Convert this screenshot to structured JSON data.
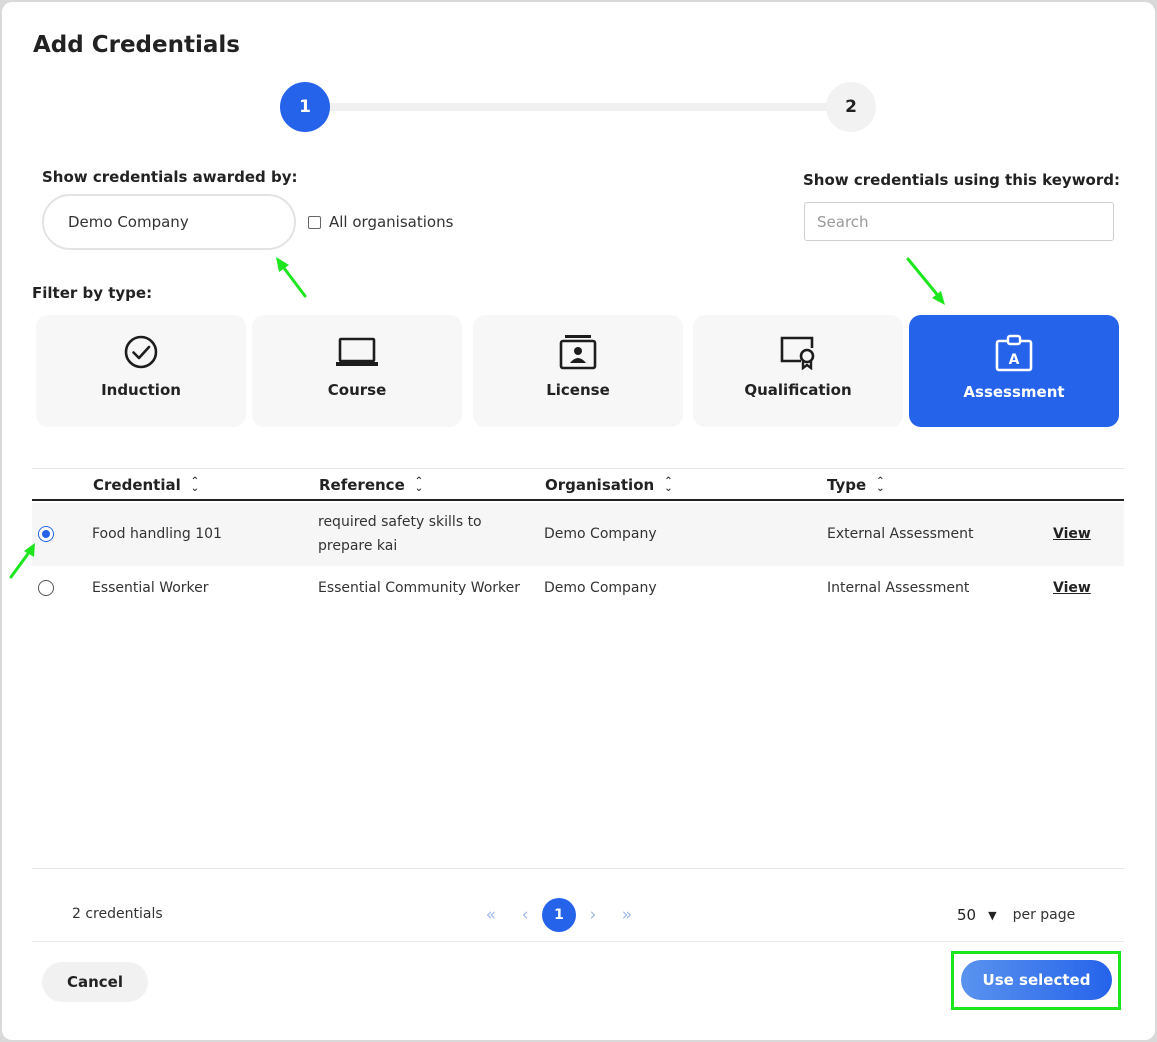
{
  "dialog": {
    "title": "Add Credentials"
  },
  "stepper": {
    "step1": "1",
    "step2": "2"
  },
  "filters": {
    "awarded_by_label": "Show credentials awarded by:",
    "awarded_by_value": "Demo Company",
    "all_orgs_label": "All organisations",
    "keyword_label": "Show credentials using this keyword:",
    "search_placeholder": "Search",
    "type_label": "Filter by type:"
  },
  "types": [
    {
      "label": "Induction",
      "icon": "check-circle-icon",
      "active": false
    },
    {
      "label": "Course",
      "icon": "laptop-icon",
      "active": false
    },
    {
      "label": "License",
      "icon": "id-badge-icon",
      "active": false
    },
    {
      "label": "Qualification",
      "icon": "certificate-icon",
      "active": false
    },
    {
      "label": "Assessment",
      "icon": "assessment-badge-icon",
      "active": true
    }
  ],
  "table": {
    "columns": [
      "Credential",
      "Reference",
      "Organisation",
      "Type"
    ],
    "rows": [
      {
        "selected": true,
        "credential": "Food handling 101",
        "reference_line1": "required safety skills to",
        "reference_line2": "prepare kai",
        "organisation": "Demo Company",
        "type": "External Assessment",
        "action": "View"
      },
      {
        "selected": false,
        "credential": "Essential Worker",
        "reference_line1": "Essential Community Worker",
        "reference_line2": "",
        "organisation": "Demo Company",
        "type": "Internal Assessment",
        "action": "View"
      }
    ]
  },
  "footer": {
    "count": "2 credentials",
    "current_page": "1",
    "per_page_value": "50",
    "per_page_label": "per page",
    "cancel_label": "Cancel",
    "use_selected_label": "Use selected"
  },
  "colors": {
    "accent": "#2563eb",
    "annotation": "#1ee61e"
  }
}
